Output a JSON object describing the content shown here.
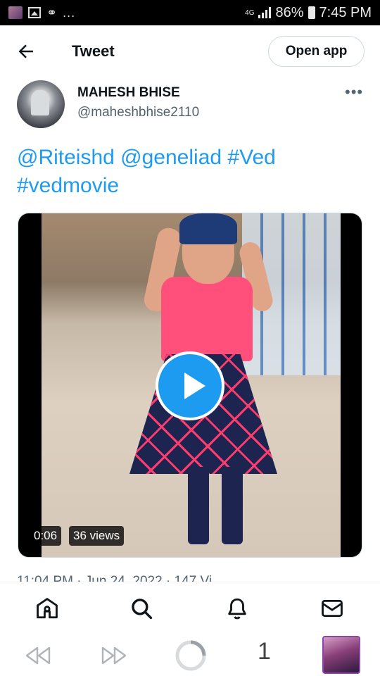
{
  "status_bar": {
    "network": "4G",
    "battery": "86%",
    "time": "7:45 PM",
    "notification_overflow": "..."
  },
  "header": {
    "title": "Tweet",
    "open_app_label": "Open app"
  },
  "author": {
    "name": "MAHESH BHISE",
    "handle": "@maheshbhise2110",
    "more_label": "•••"
  },
  "tweet": {
    "line1": "@Riteishd @geneliad #Ved",
    "line2": "#vedmovie"
  },
  "video": {
    "duration": "0:06",
    "views": "36 views"
  },
  "timestamp_partial": "11:04 PM · Jun 24, 2022 · 147 Vi",
  "bottom_nav": {
    "items": [
      "home-icon",
      "search-icon",
      "bell-icon",
      "mail-icon"
    ]
  },
  "browser_toolbar": {
    "tab_count": "1"
  },
  "colors": {
    "accent": "#1d9bf0",
    "text": "#0f1419",
    "secondary_text": "#536471"
  }
}
